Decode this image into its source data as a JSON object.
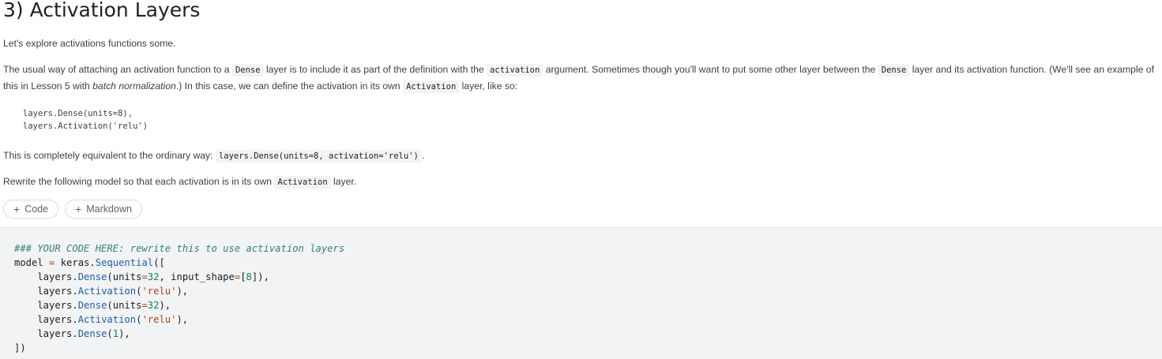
{
  "heading": "3) Activation Layers",
  "intro": "Let's explore activations functions some.",
  "para2": {
    "t1": "The usual way of attaching an activation function to a ",
    "c1": "Dense",
    "t2": " layer is to include it as part of the definition with the ",
    "c2": "activation",
    "t3": " argument. Sometimes though you'll want to put some other layer between the ",
    "c3": "Dense",
    "t4": " layer and its activation function. (We'll see an example of this in Lesson 5 with ",
    "em": "batch normalization",
    "t5": ".) In this case, we can define the activation in its own ",
    "c4": "Activation",
    "t6": " layer, like so:"
  },
  "example_code": "layers.Dense(units=8),\nlayers.Activation('relu')",
  "para3": {
    "t1": "This is completely equivalent to the ordinary way: ",
    "c1": "layers.Dense(units=8, activation='relu')",
    "t2": "."
  },
  "para4": {
    "t1": "Rewrite the following model so that each activation is in its own ",
    "c1": "Activation",
    "t2": " layer."
  },
  "buttons": {
    "code": "Code",
    "markdown": "Markdown"
  },
  "code_cell": {
    "comment": "### YOUR CODE HERE: rewrite this to use activation layers",
    "l2": {
      "a": "model ",
      "eq": "=",
      "b": " keras.",
      "fn": "Sequential",
      "c": "(["
    },
    "l3": {
      "a": "    layers.",
      "fn": "Dense",
      "b": "(units",
      "eq": "=",
      "n1": "32",
      "c": ", input_shape",
      "eq2": "=",
      "d": "[",
      "n2": "8",
      "e": "]),"
    },
    "l4": {
      "a": "    layers.",
      "fn": "Activation",
      "b": "(",
      "s": "'relu'",
      "c": "),"
    },
    "l5": {
      "a": "    layers.",
      "fn": "Dense",
      "b": "(units",
      "eq": "=",
      "n": "32",
      "c": "),"
    },
    "l6": {
      "a": "    layers.",
      "fn": "Activation",
      "b": "(",
      "s": "'relu'",
      "c": "),"
    },
    "l7": {
      "a": "    layers.",
      "fn": "Dense",
      "b": "(",
      "n": "1",
      "c": "),"
    },
    "l8": "])"
  }
}
